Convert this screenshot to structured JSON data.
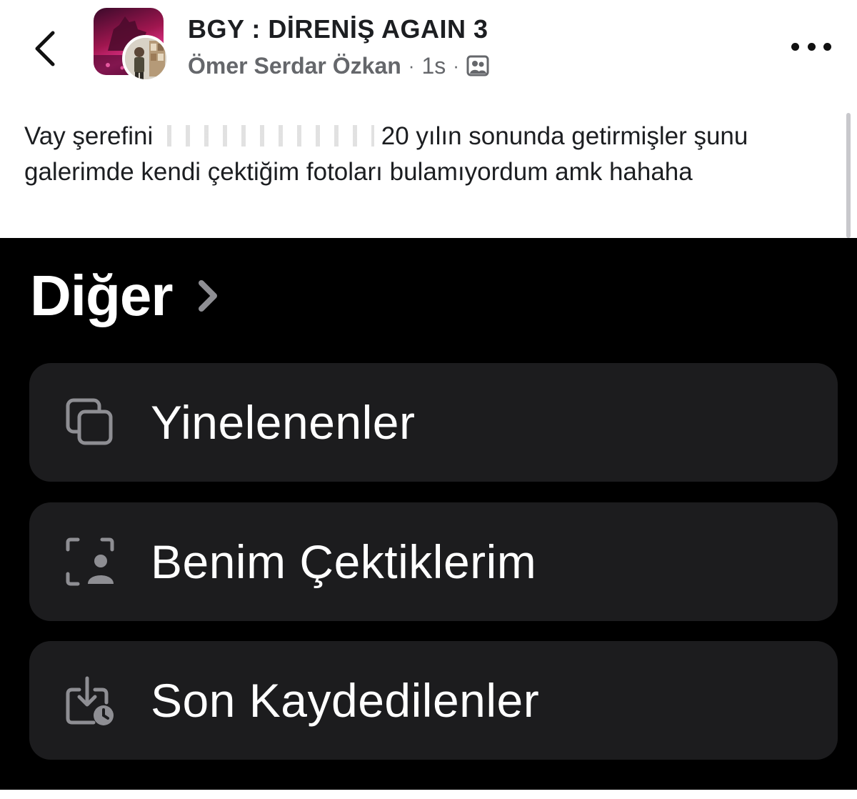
{
  "header": {
    "back_icon": "chevron-left-icon",
    "group_name": "BGY : DİRENİŞ AGAIN 3",
    "author": "Ömer Serdar Özkan",
    "separator": "·",
    "time": "1s",
    "audience_icon": "group-members-icon",
    "more_icon": "more-horizontal-icon"
  },
  "post": {
    "text_start": "Vay şerefini",
    "text_rest": " 20 yılın sonunda getirmişler şunu galerimde kendi çektiğim fotoları bulamıyordum amk hahaha"
  },
  "photo": {
    "section_title": "Diğer",
    "rows": [
      {
        "label": "Yinelenenler",
        "icon": "duplicates-icon"
      },
      {
        "label": "Benim Çektiklerim",
        "icon": "person-frame-icon"
      },
      {
        "label": "Son Kaydedilenler",
        "icon": "recently-saved-icon"
      }
    ]
  },
  "colors": {
    "text_primary": "#1c1e21",
    "text_secondary": "#65676b",
    "photo_background": "#000000",
    "row_background": "#1c1c1e",
    "row_icon": "#8e8e93",
    "avatar_accent": "#e2338a"
  }
}
